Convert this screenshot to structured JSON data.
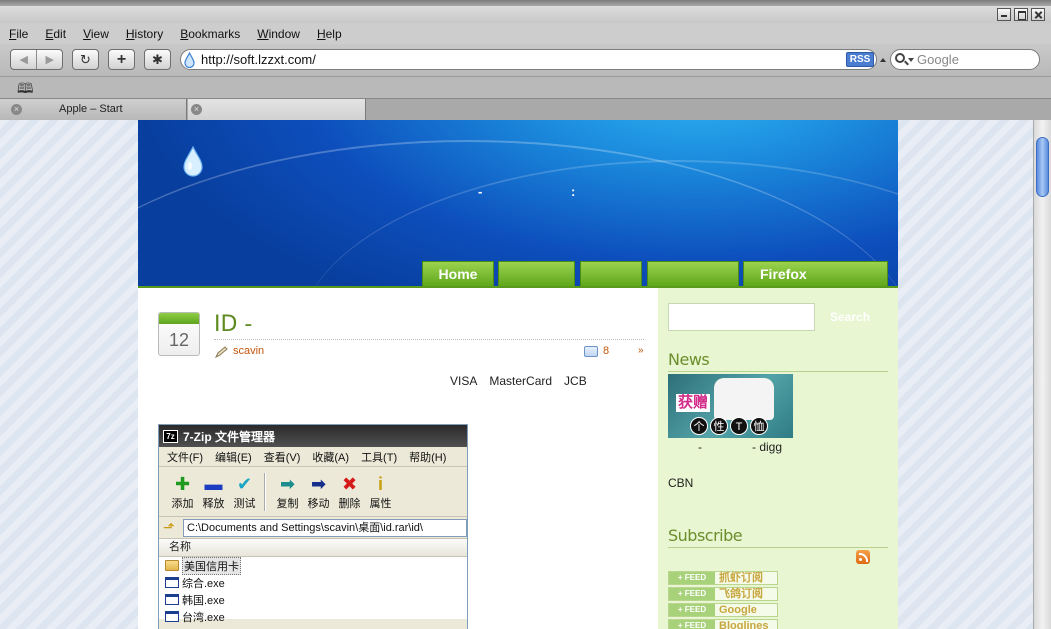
{
  "window": {
    "menus": [
      {
        "label": "File",
        "key": "F",
        "rest": "ile"
      },
      {
        "label": "Edit",
        "key": "E",
        "rest": "dit"
      },
      {
        "label": "View",
        "key": "V",
        "rest": "iew"
      },
      {
        "label": "History",
        "key": "H",
        "rest": "istory"
      },
      {
        "label": "Bookmarks",
        "key": "B",
        "rest": "ookmarks"
      },
      {
        "label": "Window",
        "key": "W",
        "rest": "indow"
      },
      {
        "label": "Help",
        "key": "H",
        "rest": "elp"
      }
    ]
  },
  "toolbar": {
    "url": "http://soft.lzzxt.com/",
    "rss_label": "RSS",
    "search_placeholder": "Google"
  },
  "tabs": [
    {
      "label": "Apple – Start"
    },
    {
      "label": ""
    }
  ],
  "site": {
    "header_dash": "-",
    "header_colon": ":",
    "nav": [
      {
        "label": "Home"
      },
      {
        "label": ""
      },
      {
        "label": ""
      },
      {
        "label": ""
      },
      {
        "label": "Firefox"
      }
    ]
  },
  "post": {
    "day": "12",
    "title": "ID -",
    "author": "scavin",
    "comments": "8",
    "more": "»",
    "cards": [
      "VISA",
      "MasterCard",
      "JCB"
    ]
  },
  "sevenzip": {
    "title": "7-Zip 文件管理器",
    "logo": "7z",
    "menu": [
      "文件(F)",
      "编辑(E)",
      "查看(V)",
      "收藏(A)",
      "工具(T)",
      "帮助(H)"
    ],
    "tools": [
      {
        "label": "添加",
        "glyph": "✚",
        "color": "#1f9a1f"
      },
      {
        "label": "释放",
        "glyph": "▬",
        "color": "#1c3cc2"
      },
      {
        "label": "测试",
        "glyph": "✔",
        "color": "#19a6c4"
      },
      {
        "label": "复制",
        "glyph": "➡",
        "color": "#1d8c8c"
      },
      {
        "label": "移动",
        "glyph": "➡",
        "color": "#162f8c"
      },
      {
        "label": "删除",
        "glyph": "✖",
        "color": "#d61a1a"
      },
      {
        "label": "属性",
        "glyph": "i",
        "color": "#c7a012"
      }
    ],
    "path": "C:\\Documents and Settings\\scavin\\桌面\\id.rar\\id\\",
    "column": "名称",
    "files": [
      {
        "name": "美国信用卡",
        "type": "folder"
      },
      {
        "name": "综合.exe",
        "type": "exe"
      },
      {
        "name": "韩国.exe",
        "type": "exe"
      },
      {
        "name": "台湾.exe",
        "type": "exe"
      }
    ]
  },
  "sidebar": {
    "search_button": "Search",
    "news_heading": "News",
    "news_banner": {
      "text": "获赠",
      "chars": [
        "个",
        "性",
        "T",
        "恤"
      ]
    },
    "news_caption_a": "-",
    "news_caption_b": "- digg",
    "cbn": "CBN",
    "subscribe_heading": "Subscribe",
    "feeds": [
      {
        "badge": "+ FEED",
        "label": "抓虾订阅"
      },
      {
        "badge": "+ FEED",
        "label": "飞鸽订阅"
      },
      {
        "badge": "+ FEED",
        "label": "Google"
      },
      {
        "badge": "+ FEED",
        "label": "Bloglines"
      }
    ]
  }
}
